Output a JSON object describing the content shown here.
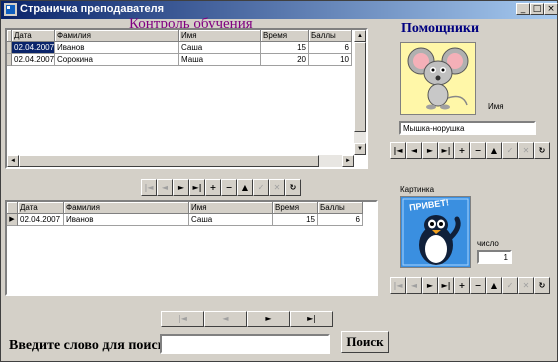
{
  "window": {
    "title": "Страничка преподавателя",
    "minimize_glyph": "_",
    "maximize_glyph": "□",
    "close_glyph": "×"
  },
  "main_title": "Контроль обучения",
  "top_grid": {
    "columns": [
      "Дата",
      "Фамилия",
      "Имя",
      "Время",
      "Баллы"
    ],
    "rows": [
      {
        "date": "02.04.2007",
        "surname": "Иванов",
        "name": "Саша",
        "time": "15",
        "score": "6"
      },
      {
        "date": "02.04.2007",
        "surname": "Сорокина",
        "name": "Маша",
        "time": "20",
        "score": "10"
      }
    ]
  },
  "bottom_grid": {
    "columns": [
      "Дата",
      "Фамилия",
      "Имя",
      "Время",
      "Баллы"
    ],
    "rows": [
      {
        "date": "02.04.2007",
        "surname": "Иванов",
        "name": "Саша",
        "time": "15",
        "score": "6"
      }
    ]
  },
  "navigator": {
    "first": "|◄",
    "prior": "◄",
    "next": "►",
    "last": "►|",
    "insert": "+",
    "delete": "−",
    "edit": "▲",
    "post": "✓",
    "cancel": "✕",
    "refresh": "↻"
  },
  "helpers": {
    "title": "Помощники",
    "name_label": "Имя",
    "name_value": "Мышка-норушка",
    "picture_label": "Картинка",
    "number_label": "число",
    "number_value": "1",
    "penguin_text": "ПРИВЕТ!"
  },
  "search": {
    "label": "Введите слово для поиска",
    "value": "",
    "button": "Поиск",
    "nav_first": "|◄",
    "nav_prior": "◄",
    "nav_next": "►",
    "nav_last": "►|"
  },
  "colors": {
    "title_bar": "#0a246a",
    "main_title": "#800080",
    "helpers_title": "#000080",
    "selection": "#0a246a"
  }
}
